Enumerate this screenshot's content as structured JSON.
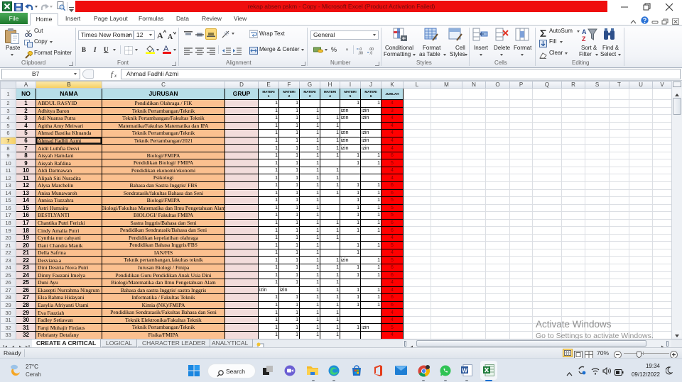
{
  "window": {
    "title": "rekap absen pskm - Copy  -  Microsoft Excel (Product Activation Failed)"
  },
  "ribbon": {
    "tabs": {
      "file": "File",
      "home": "Home",
      "insert": "Insert",
      "page_layout": "Page Layout",
      "formulas": "Formulas",
      "data": "Data",
      "review": "Review",
      "view": "View"
    },
    "active_tab": "Home",
    "clipboard": {
      "label": "Clipboard",
      "paste": "Paste",
      "cut": "Cut",
      "copy": "Copy",
      "format_painter": "Format Painter"
    },
    "font": {
      "label": "Font",
      "font_name": "Times New Roman",
      "font_size": "12",
      "bold": "B",
      "italic": "I",
      "underline": "U"
    },
    "alignment": {
      "label": "Alignment",
      "wrap_text": "Wrap Text",
      "merge_center": "Merge & Center",
      "active_vertical_align": "bottom"
    },
    "number": {
      "label": "Number",
      "format": "General",
      "percent": "%",
      "comma": ","
    },
    "styles": {
      "label": "Styles",
      "conditional_formatting": [
        "Conditional",
        "Formatting"
      ],
      "format_as_table": [
        "Format",
        "as Table"
      ],
      "cell_styles": [
        "Cell",
        "Styles"
      ]
    },
    "cells": {
      "label": "Cells",
      "insert": "Insert",
      "delete": "Delete",
      "format": "Format"
    },
    "editing": {
      "label": "Editing",
      "autosum": "AutoSum",
      "fill": "Fill",
      "clear": "Clear",
      "sort_filter": [
        "Sort &",
        "Filter"
      ],
      "find_select": [
        "Find &",
        "Select"
      ]
    }
  },
  "formula_bar": {
    "name_box": "B7",
    "content": "Ahmad Fadhli Azmi"
  },
  "sheet": {
    "columns": [
      "A",
      "B",
      "C",
      "D",
      "E",
      "F",
      "G",
      "H",
      "I",
      "J",
      "K",
      "L",
      "M",
      "N",
      "O",
      "P",
      "Q",
      "R",
      "S",
      "T",
      "U",
      "V"
    ],
    "row_headers": [
      "1",
      "2",
      "3",
      "4",
      "5",
      "6",
      "7",
      "8",
      "9",
      "10",
      "11",
      "12",
      "13",
      "14",
      "15",
      "16",
      "17",
      "18",
      "19",
      "20",
      "21",
      "22",
      "23",
      "24",
      "25",
      "26",
      "27",
      "28",
      "29",
      "30",
      "31",
      "32",
      "33"
    ],
    "header": {
      "no": "NO",
      "nama": "NAMA",
      "jurusan": "JURUSAN",
      "grup": "GRUP",
      "materi": [
        {
          "label": "MATERI",
          "number": "1"
        },
        {
          "label": "MATERI",
          "number": "2"
        },
        {
          "label": "MATERI",
          "number": "3"
        },
        {
          "label": "MATERI",
          "number": "4"
        },
        {
          "label": "MATERI",
          "number": "5"
        },
        {
          "label": "MATERI",
          "number": "6"
        }
      ],
      "jumlah": "JUMLAH"
    },
    "rows": [
      {
        "no": "1",
        "nama": "ABDUL RASYID",
        "jurusan": "Pendidikan Olahraga / FIK",
        "grup": "",
        "materi": [
          "1",
          "1",
          "",
          "",
          "1",
          "1"
        ],
        "jumlah": "4"
      },
      {
        "no": "2",
        "nama": "Adhitya Baron",
        "jurusan": "Teknik Pertambangan/Teknik",
        "grup": "",
        "materi": [
          "1",
          "1",
          "1",
          "",
          "izin",
          "izin"
        ],
        "jumlah": "3"
      },
      {
        "no": "3",
        "nama": "Adi Nuansa Putra",
        "jurusan": "Teknik Pertambangan/Fakultas Teknik",
        "grup": "",
        "materi": [
          "1",
          "1",
          "1",
          "1",
          "izin",
          "izin"
        ],
        "jumlah": "4"
      },
      {
        "no": "4",
        "nama": "Agitha Amy Meiwari",
        "jurusan": "Matematika/Fakultas Matematika dan IPA",
        "grup": "",
        "materi": [
          "1",
          "1",
          "1",
          "1",
          "",
          ""
        ],
        "jumlah": "4"
      },
      {
        "no": "5",
        "nama": "Ahmad Bastika Khuanda",
        "jurusan": "Teknik Pertambangan/Teknik",
        "grup": "",
        "materi": [
          "1",
          "1",
          "1",
          "1",
          "izin",
          "izin"
        ],
        "jumlah": "4"
      },
      {
        "no": "6",
        "nama": "Ahmad Fadhli Azmi",
        "jurusan": "Teknik Pertambangan/2021",
        "grup": "",
        "materi": [
          "1",
          "1",
          "1",
          "1",
          "izin",
          "izin"
        ],
        "jumlah": "4"
      },
      {
        "no": "7",
        "nama": "Aidil Luthfia Desvi",
        "jurusan": "",
        "grup": "",
        "materi": [
          "1",
          "1",
          "1",
          "1",
          "izin",
          "izin"
        ],
        "jumlah": "4"
      },
      {
        "no": "8",
        "nama": "Aisyah Hamdani",
        "jurusan": "Biologi/FMIPA",
        "grup": "",
        "materi": [
          "1",
          "1",
          "1",
          "1",
          "1",
          "1"
        ],
        "jumlah": "6"
      },
      {
        "no": "9",
        "nama": "Aisyah Rafdina",
        "jurusan": "Pendidikan Biologi/ FMIPA",
        "grup": "",
        "materi": [
          "1",
          "1",
          "1",
          "",
          "1",
          "1"
        ],
        "jumlah": "5"
      },
      {
        "no": "10",
        "nama": "Aldi Darmawan",
        "jurusan": "Pendidikan ekonomi/ekonomi",
        "grup": "",
        "materi": [
          "1",
          "1",
          "1",
          "1",
          "",
          ""
        ],
        "jumlah": "4"
      },
      {
        "no": "11",
        "nama": "Alipah Siti Nuradita",
        "jurusan": "Psikologi",
        "grup": "",
        "materi": [
          "1",
          "1",
          "1",
          "1",
          "",
          ""
        ],
        "jumlah": "4"
      },
      {
        "no": "12",
        "nama": "Alysa Marchelin",
        "jurusan": "Bahasa dan Sastra Inggris/ FBS",
        "grup": "",
        "materi": [
          "1",
          "1",
          "1",
          "1",
          "1",
          "1"
        ],
        "jumlah": "6"
      },
      {
        "no": "13",
        "nama": "Anisa Munawaroh",
        "jurusan": "Sendratasik/fakultas Bahasa dan Seni",
        "grup": "",
        "materi": [
          "1",
          "1",
          "1",
          "1",
          "1",
          "1"
        ],
        "jumlah": "6"
      },
      {
        "no": "14",
        "nama": "Annisa Tuzzahra",
        "jurusan": "Biologi/FMIPA",
        "grup": "",
        "materi": [
          "1",
          "1",
          "1",
          "",
          "1",
          "1"
        ],
        "jumlah": "5"
      },
      {
        "no": "15",
        "nama": "Astri Humaira",
        "jurusan": "Biologi/Fakultas Matematika dan Ilmu Pengetahuan Alam",
        "grup": "",
        "materi": [
          "1",
          "1",
          "1",
          "",
          "1",
          "1"
        ],
        "jumlah": "5"
      },
      {
        "no": "16",
        "nama": "BESTLYANTI",
        "jurusan": "BIOLOGI/ Fakultas FMIPA",
        "grup": "",
        "materi": [
          "1",
          "1",
          "1",
          "",
          "1",
          "1"
        ],
        "jumlah": "5"
      },
      {
        "no": "17",
        "nama": "Chantika Putri Ferizki",
        "jurusan": "Sastra Inggris/Bahasa dan Seni",
        "grup": "",
        "materi": [
          "1",
          "1",
          "1",
          "1",
          "1",
          "1"
        ],
        "jumlah": "6"
      },
      {
        "no": "18",
        "nama": "Cindy Amalia Putri",
        "jurusan": "Pendidikan Sendratasik/Bahasa dan Seni",
        "grup": "",
        "materi": [
          "1",
          "1",
          "1",
          "1",
          "1",
          "1"
        ],
        "jumlah": "6"
      },
      {
        "no": "19",
        "nama": "Cynthia nur cahyani",
        "jurusan": "Pendidikan kepelatihan olahraga",
        "grup": "",
        "materi": [
          "1",
          "1",
          "1",
          "1",
          "",
          ""
        ],
        "jumlah": "4"
      },
      {
        "no": "20",
        "nama": "Dani Chandra Manik",
        "jurusan": "Pendidikan Bahasa Inggris/FBS",
        "grup": "",
        "materi": [
          "1",
          "1",
          "1",
          "",
          "1",
          "1"
        ],
        "jumlah": "5"
      },
      {
        "no": "21",
        "nama": "Della Safrina",
        "jurusan": "IAN/FIS",
        "grup": "",
        "materi": [
          "1",
          "1",
          "1",
          "",
          "1",
          ""
        ],
        "jumlah": "4"
      },
      {
        "no": "22",
        "nama": "Desviana.a",
        "jurusan": "Teknik pertambangan,fakultas teknik",
        "grup": "",
        "materi": [
          "1",
          "1",
          "1",
          "1",
          "izin",
          "1"
        ],
        "jumlah": "5"
      },
      {
        "no": "23",
        "nama": "Dini Destria Nova Putri",
        "jurusan": "Jurusan Biologi / Fmipa",
        "grup": "",
        "materi": [
          "1",
          "1",
          "1",
          "1",
          "1",
          "1"
        ],
        "jumlah": "6"
      },
      {
        "no": "24",
        "nama": "Dinny Fauzani Imelya",
        "jurusan": "Pendidikan Guru Pendidikan Anak Usia Dini",
        "grup": "",
        "materi": [
          "1",
          "1",
          "1",
          "1",
          "1",
          "1"
        ],
        "jumlah": "6"
      },
      {
        "no": "25",
        "nama": "Duni Ayu",
        "jurusan": "Biologi/Matematika dan Ilmu Pengetahuan Alam",
        "grup": "",
        "materi": [
          "1",
          "1",
          "1",
          "1",
          "",
          ""
        ],
        "jumlah": "4"
      },
      {
        "no": "26",
        "nama": "Ekasepti Nurrahma Ningrum",
        "jurusan": "Bahasa dan sastra Inggris/ sastra Inggris",
        "grup": "",
        "materi": [
          "izin",
          "izin",
          "1",
          "1",
          "1",
          "1"
        ],
        "jumlah": "4"
      },
      {
        "no": "27",
        "nama": "Elsa Rahma Hidayani",
        "jurusan": "Informatika / Fakultas Teknik",
        "grup": "",
        "materi": [
          "1",
          "1",
          "1",
          "1",
          "1",
          "1"
        ],
        "jumlah": "6"
      },
      {
        "no": "28",
        "nama": "Easylia Afriyanti Utami",
        "jurusan": "Kimia (NK)/FMIPA",
        "grup": "",
        "materi": [
          "1",
          "1",
          "1",
          "1",
          "1",
          "1"
        ],
        "jumlah": "6"
      },
      {
        "no": "29",
        "nama": "Eva Fauziah",
        "jurusan": "Pendidikan Sendratasik/Fakultas Bahasa dan Seni",
        "grup": "",
        "materi": [
          "1",
          "1",
          "1",
          "1",
          "",
          ""
        ],
        "jumlah": "4"
      },
      {
        "no": "30",
        "nama": "Fadley Setiawan",
        "jurusan": "Teknik Elektronika/Fakultas Teknik",
        "grup": "",
        "materi": [
          "1",
          "1",
          "1",
          "1",
          "",
          ""
        ],
        "jumlah": "4"
      },
      {
        "no": "31",
        "nama": "Farqi Muhajir Firdaus",
        "jurusan": "Teknik Pertambangan/Teknik",
        "grup": "",
        "materi": [
          "1",
          "1",
          "1",
          "1",
          "1",
          "izin"
        ],
        "jumlah": "5"
      },
      {
        "no": "32",
        "nama": "Febrianty Detafany",
        "jurusan": "Fisika/FMIPA",
        "grup": "",
        "materi": [
          "1",
          "1",
          "1",
          "1",
          "",
          ""
        ],
        "jumlah": "4"
      }
    ]
  },
  "sheet_tabs": [
    {
      "label": "CREATE A CRITICAL",
      "active": true
    },
    {
      "label": "LOGICAL",
      "active": false
    },
    {
      "label": "CHARACTER LEADER",
      "active": false
    },
    {
      "label": "ANALYTICAL",
      "active": false
    }
  ],
  "status_bar": {
    "status": "Ready",
    "zoom": "70%",
    "zoom_fraction": 0.7
  },
  "watermark": {
    "title": "Activate Windows",
    "subtitle": "Go to Settings to activate Windows."
  },
  "taskbar": {
    "weather": {
      "temp": "27°C",
      "condition": "Cerah"
    },
    "search": "Search",
    "apps": [
      "task-view",
      "meet",
      "file-explorer",
      "edge",
      "microsoft-store",
      "office",
      "mail",
      "chrome",
      "whatsapp",
      "word",
      "excel"
    ],
    "active_app": "excel",
    "clock": {
      "time": "19:34",
      "date": "09/12/2022"
    }
  },
  "colors": {
    "title_bar": "#ef0d0d",
    "file_tab": "#2a8a3b",
    "header_fill": "#b7dee8",
    "no_fill": "#f2dcdb",
    "name_fill": "#fbc08f",
    "grup_fill": "#f2dcdb",
    "jumlah_fill": "#ff0000",
    "jumlah_text": "#8b0000",
    "selection_header": "#f6cf60"
  }
}
